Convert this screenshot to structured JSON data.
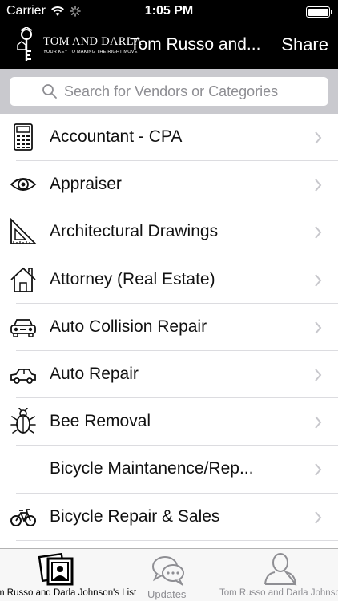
{
  "status_bar": {
    "carrier": "Carrier",
    "time": "1:05 PM"
  },
  "nav": {
    "logo_title": "TOM AND DARLA",
    "logo_tagline": "YOUR KEY TO MAKING THE RIGHT MOVE",
    "title": "Tom Russo and...",
    "share_label": "Share"
  },
  "search": {
    "placeholder": "Search for Vendors or Categories"
  },
  "categories": [
    {
      "label": "Accountant - CPA",
      "icon": "calculator-icon"
    },
    {
      "label": "Appraiser",
      "icon": "eye-icon"
    },
    {
      "label": "Architectural Drawings",
      "icon": "set-square-icon"
    },
    {
      "label": "Attorney (Real Estate)",
      "icon": "house-icon"
    },
    {
      "label": "Auto Collision Repair",
      "icon": "car-front-icon"
    },
    {
      "label": "Auto Repair",
      "icon": "car-side-icon"
    },
    {
      "label": "Bee Removal",
      "icon": "bug-icon"
    },
    {
      "label": "Bicycle Maintanence/Rep...",
      "icon": ""
    },
    {
      "label": "Bicycle Repair & Sales",
      "icon": "bicycle-icon"
    }
  ],
  "tabs": [
    {
      "label": "m Russo and Darla Johnson's List",
      "icon": "photos-icon",
      "selected": true
    },
    {
      "label": "Updates",
      "icon": "chat-bubbles-icon",
      "selected": false
    },
    {
      "label": "Tom Russo and Darla Johnso",
      "icon": "person-icon",
      "selected": false
    }
  ],
  "colors": {
    "nav_background": "#000000",
    "search_bar_background": "#c9c9ce",
    "tab_selected": "#000000",
    "tab_unselected": "#8e8e93",
    "chevron": "#c7c7cc"
  }
}
